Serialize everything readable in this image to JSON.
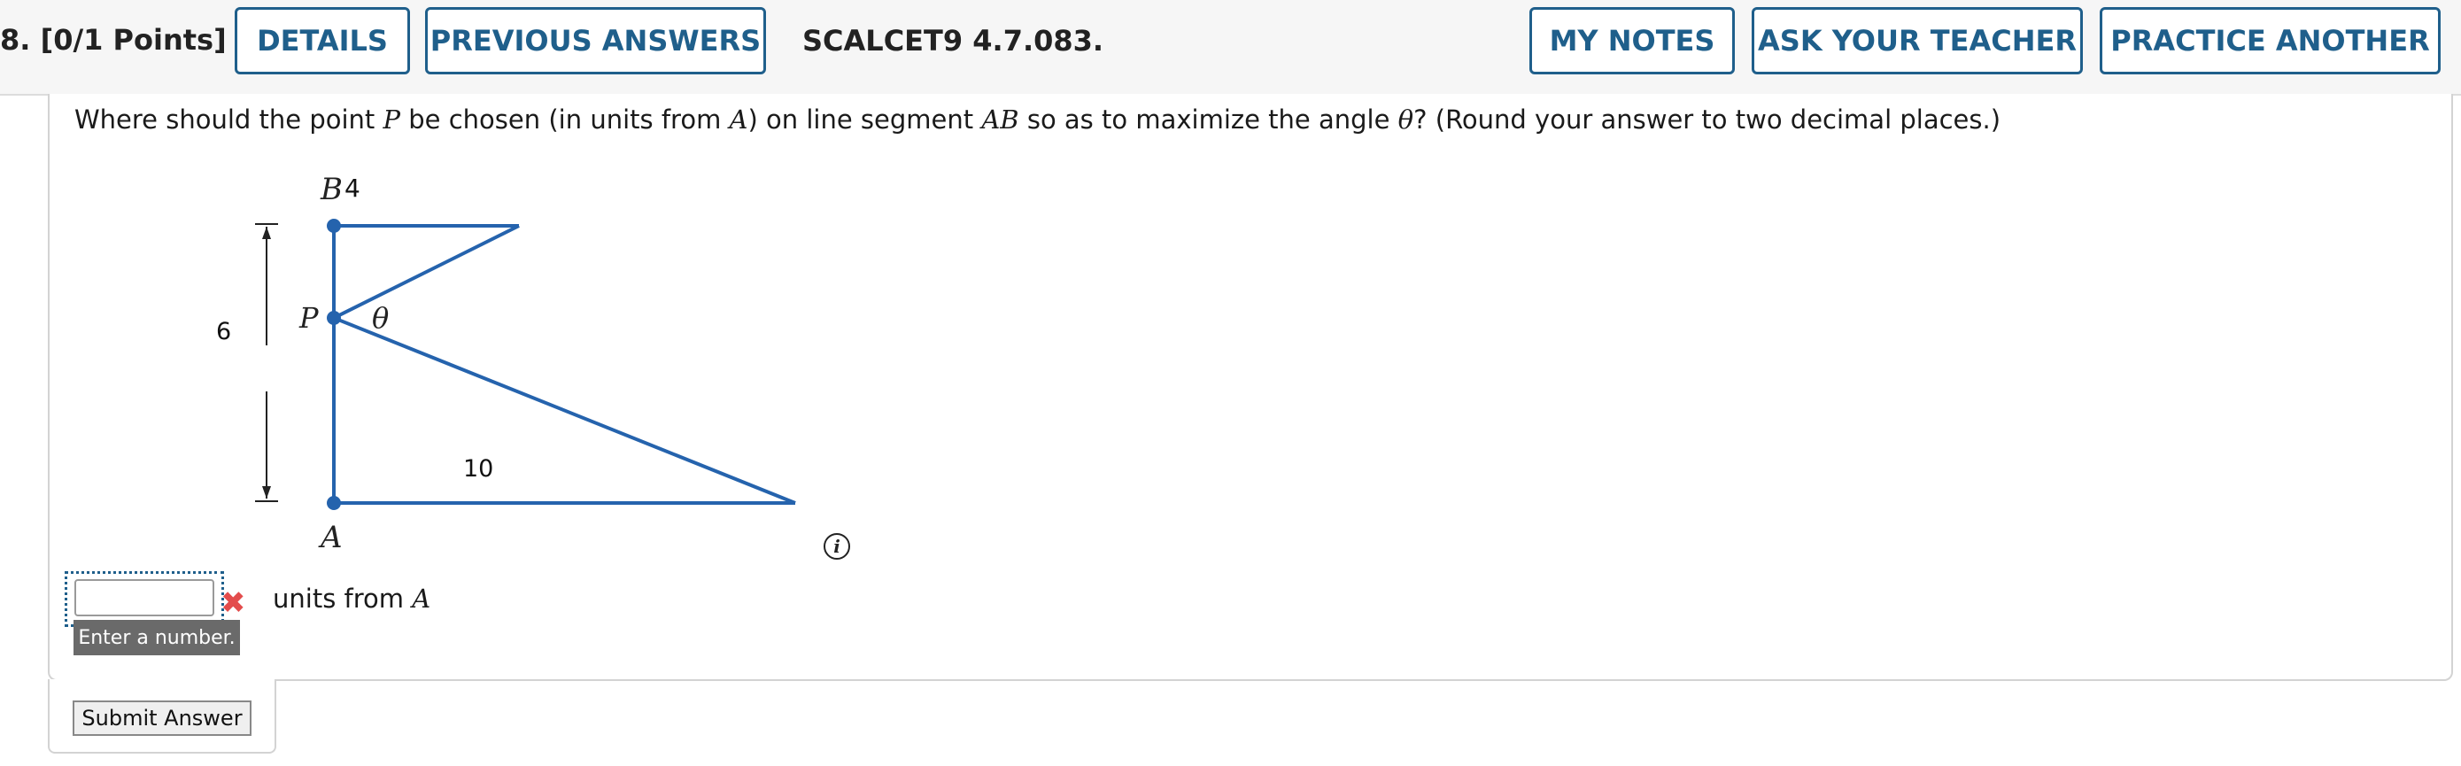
{
  "header": {
    "question_number": "8.",
    "points": "[0/1 Points]",
    "details_label": "DETAILS",
    "previous_answers_label": "PREVIOUS ANSWERS",
    "problem_code": "SCALCET9 4.7.083.",
    "my_notes_label": "MY NOTES",
    "ask_teacher_label": "ASK YOUR TEACHER",
    "practice_another_label": "PRACTICE ANOTHER"
  },
  "question": {
    "text_1": "Where should the point ",
    "var_p": "P",
    "text_2": " be chosen (in units from ",
    "var_a": "A",
    "text_3": ") on line segment ",
    "var_ab": "AB",
    "text_4": " so as to maximize the angle ",
    "var_theta": "θ",
    "text_5": "? (Round your answer to two decimal places.)"
  },
  "figure": {
    "label_b": "B",
    "label_b_value": "4",
    "label_p": "P",
    "label_theta": "θ",
    "label_a": "A",
    "label_height": "6",
    "label_bottom": "10",
    "line_color": "#2563ad"
  },
  "answer": {
    "value": "",
    "placeholder": "",
    "units_text": "units from ",
    "units_var": "A",
    "error_tooltip": "Enter a number.",
    "status": "incorrect"
  },
  "submit_label": "Submit Answer"
}
